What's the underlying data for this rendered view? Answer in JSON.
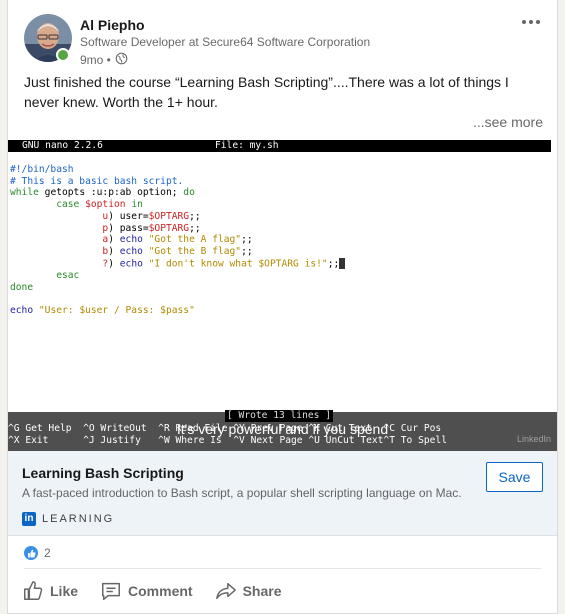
{
  "post": {
    "author_name": "Al Piepho",
    "author_headline": "Software Developer at Secure64 Software Corporation",
    "time_ago": "9mo •",
    "text": "Just finished the course “Learning Bash Scripting”....There was a lot of things I never knew.  Worth the 1+ hour.",
    "see_more": "...see more"
  },
  "terminal": {
    "nano_version": "GNU nano 2.2.6",
    "file_label": "File: my.sh",
    "status_message": "[ Wrote 13 lines ]",
    "help_row_1": "^G Get Help  ^O WriteOut  ^R Read File ^Y Prev Page ^K Cut Text  ^C Cur Pos",
    "help_row_2": "^X Exit      ^J Justify   ^W Where Is  ^V Next Page ^U UnCut Text^T To Spell",
    "caption": "It's very powerful and if you spend",
    "watermark": "LinkedIn"
  },
  "link_preview": {
    "title": "Learning Bash Scripting",
    "description": "A fast-paced introduction to Bash script, a popular shell scripting language on Mac...",
    "brand_letters": "in",
    "brand_text": "LEARNING",
    "save_label": "Save"
  },
  "social": {
    "reaction_count": "2",
    "like_label": "Like",
    "comment_label": "Comment",
    "share_label": "Share"
  },
  "colors": {
    "accent": "#0a66c2",
    "presence": "#57a641",
    "reaction": "#378fe9"
  }
}
